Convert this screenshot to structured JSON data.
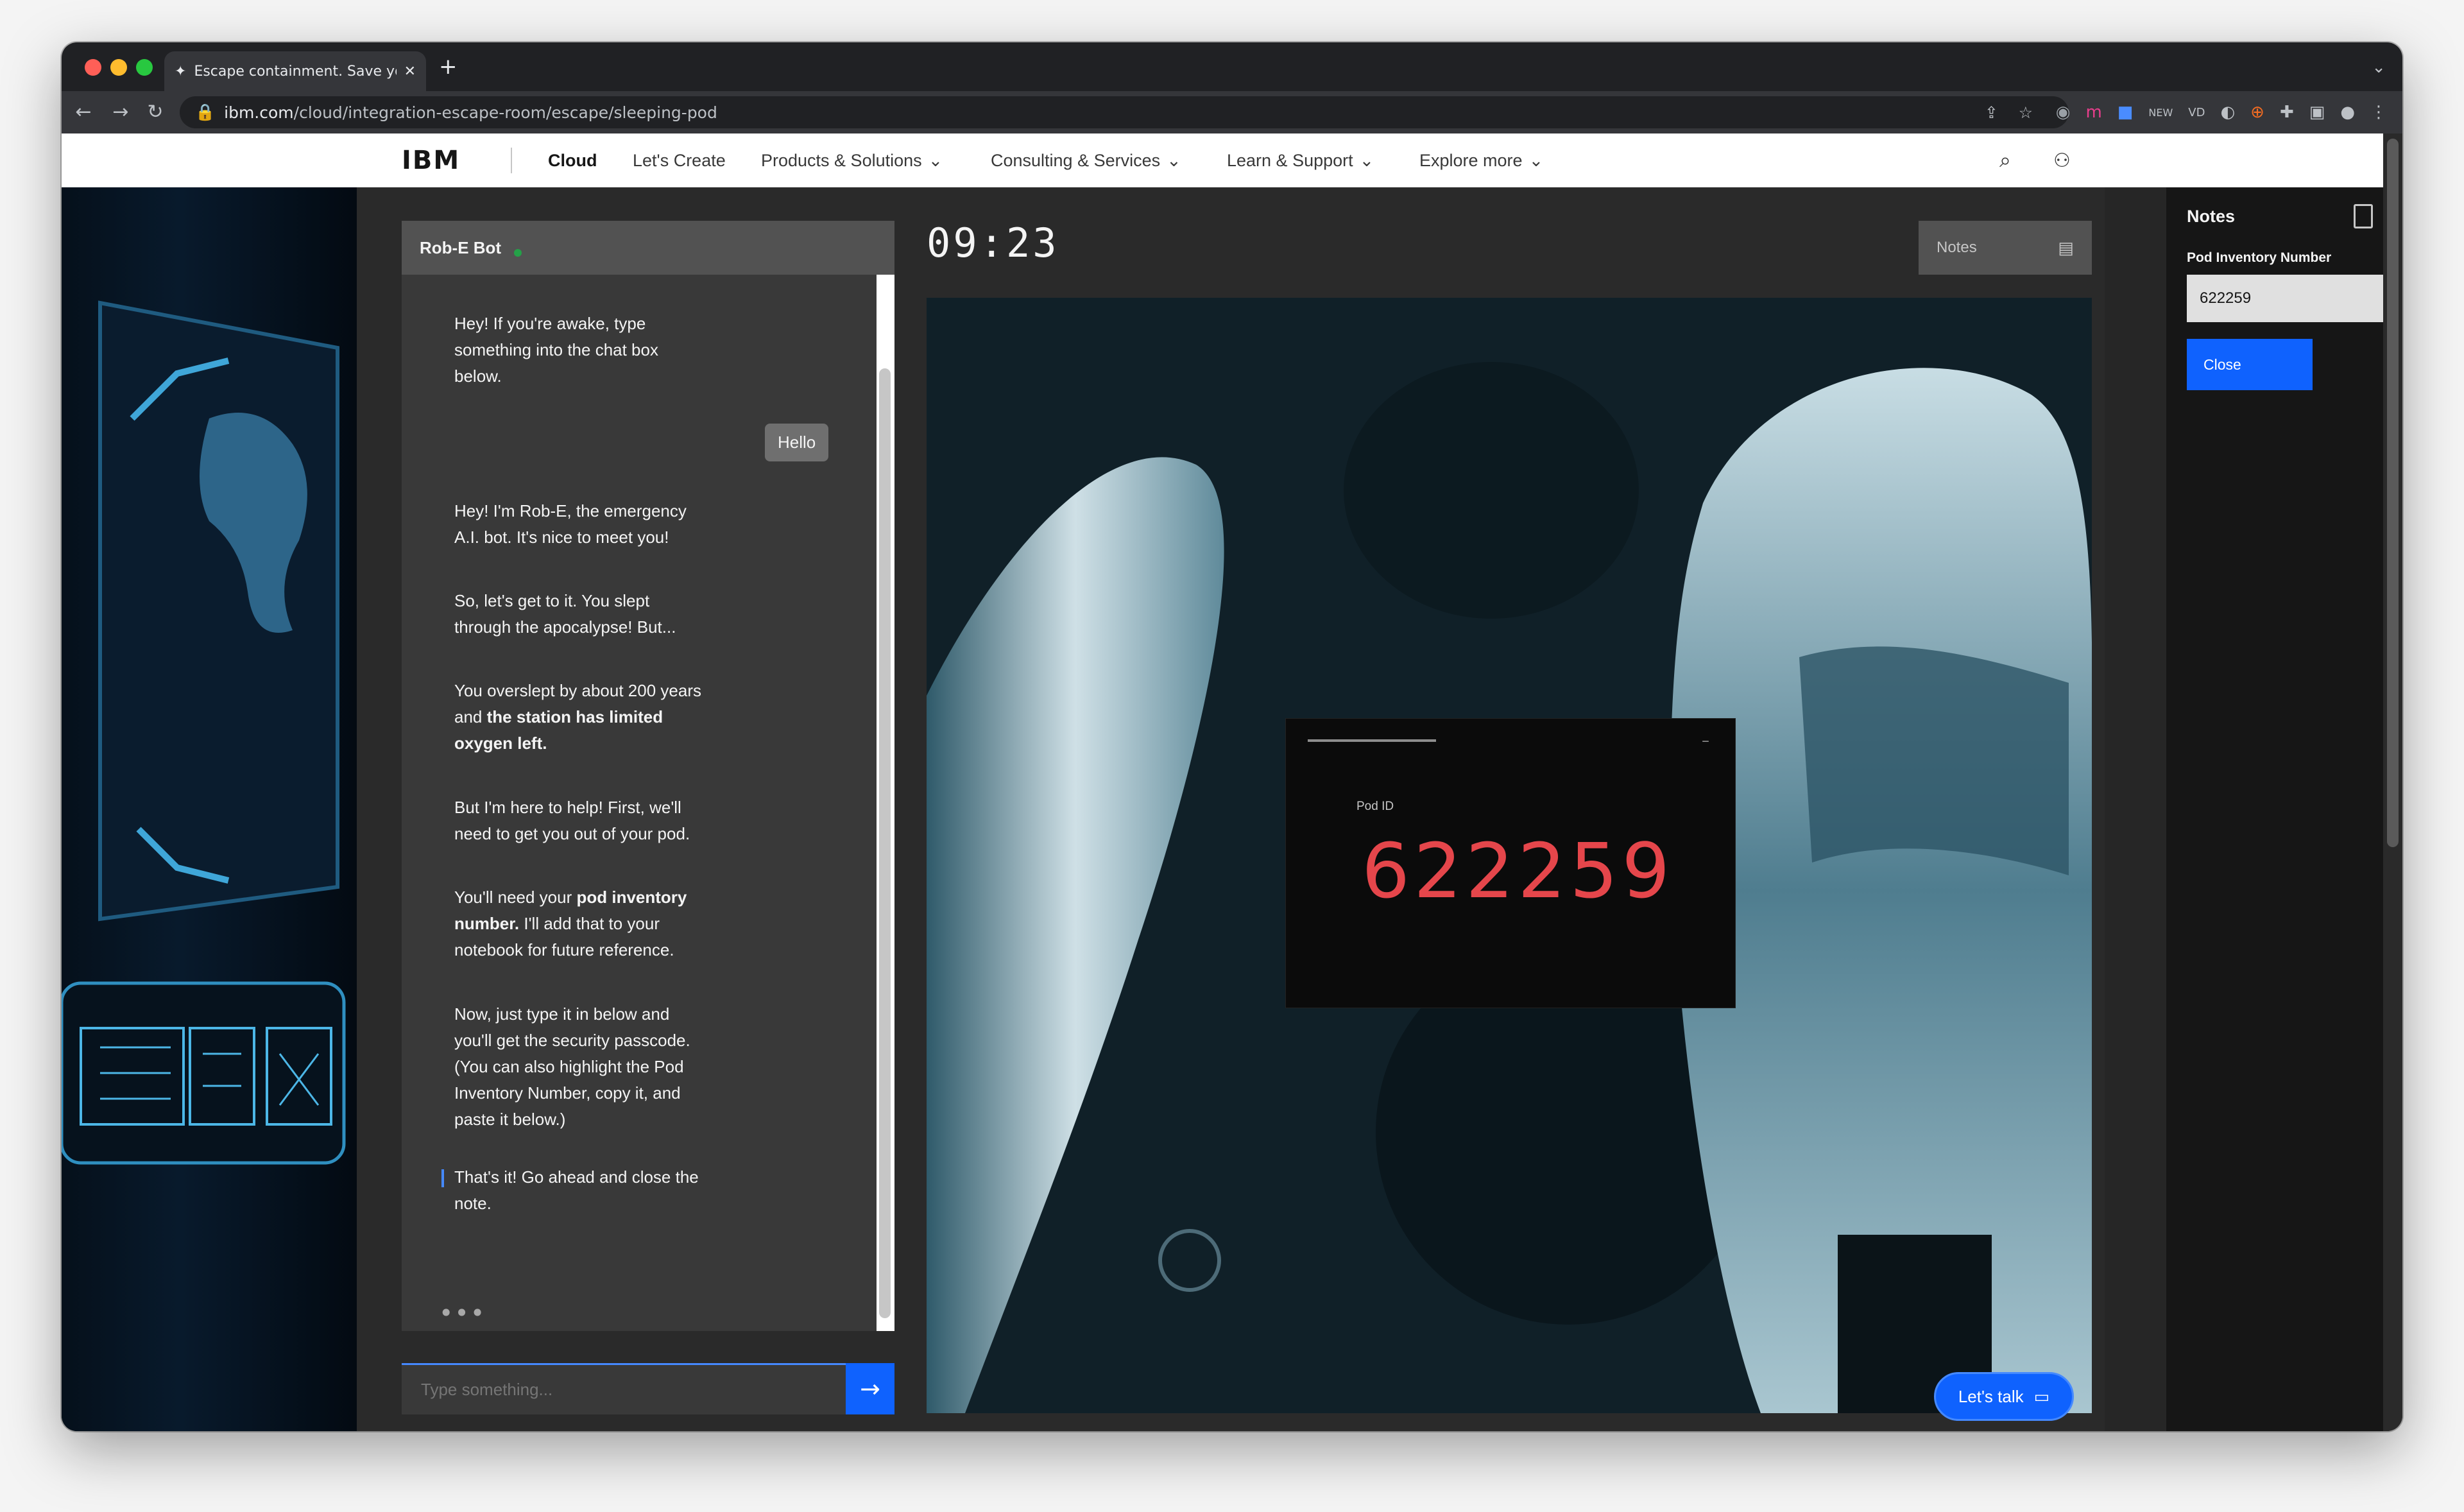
{
  "browser": {
    "tab_title": "Escape containment. Save yourself",
    "new_tab": "+",
    "url_host": "ibm.com",
    "url_path": "/cloud/integration-escape-room/escape/sleeping-pod"
  },
  "nav": {
    "logo": "IBM",
    "items": [
      "Cloud",
      "Let's Create",
      "Products & Solutions",
      "Consulting & Services",
      "Learn & Support",
      "Explore more"
    ]
  },
  "chat": {
    "bot_name": "Rob-E Bot",
    "user_message": "Hello",
    "messages": [
      "Hey! If you're awake, type\nsomething into the chat box\nbelow.",
      "Hey! I'm Rob-E, the emergency\nA.I. bot. It's nice to meet you!",
      "So, let's get to it. You slept\nthrough the apocalypse! But...",
      "You overslept by about 200 years\nand the station has limited\noxygen left.",
      "But I'm here to help! First, we'll\nneed to get you out of your pod.",
      "You'll need your pod inventory\nnumber. I'll add that to your\nnotebook for future reference.",
      "Now, just type it in below and\nyou'll get the security passcode.\n(You can also highlight the Pod\nInventory Number, copy it, and\npaste it below.)",
      "That's it! Go ahead and close the\nnote."
    ],
    "typing": "•••",
    "input_placeholder": "Type something..."
  },
  "game": {
    "timer": "09:23",
    "notes_button": "Notes",
    "pod_label": "Pod ID",
    "pod_id": "622259",
    "pod_minimize": "–",
    "lets_talk": "Let's talk"
  },
  "notes_panel": {
    "title": "Notes",
    "field_label": "Pod Inventory Number",
    "field_value": "622259",
    "close": "Close"
  }
}
